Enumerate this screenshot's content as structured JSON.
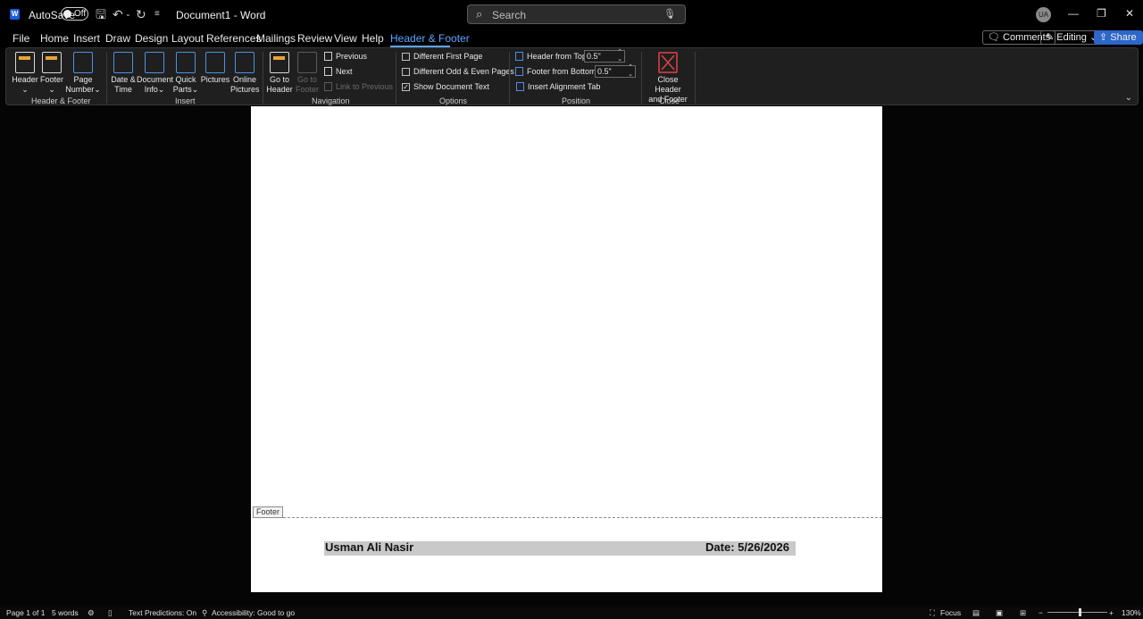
{
  "titlebar": {
    "logo": "W",
    "autosave_label": "AutoSave",
    "autosave_state": "Off",
    "doc_title": "Document1  -  Word",
    "search_placeholder": "Search",
    "avatar_initials": "UA"
  },
  "menu": {
    "items": [
      "File",
      "Home",
      "Insert",
      "Draw",
      "Design",
      "Layout",
      "References",
      "Mailings",
      "Review",
      "View",
      "Help",
      "Header & Footer"
    ],
    "comments": "Comments",
    "editing": "Editing",
    "share": "Share"
  },
  "ribbon": {
    "header_footer_group": {
      "label": "Header & Footer",
      "header": "Header",
      "footer": "Footer",
      "page_number_1": "Page",
      "page_number_2": "Number"
    },
    "insert_group": {
      "label": "Insert",
      "date_time_1": "Date &",
      "date_time_2": "Time",
      "doc_info_1": "Document",
      "doc_info_2": "Info",
      "quick_parts_1": "Quick",
      "quick_parts_2": "Parts",
      "pictures": "Pictures",
      "online_pictures_1": "Online",
      "online_pictures_2": "Pictures"
    },
    "navigation_group": {
      "label": "Navigation",
      "goto_header_1": "Go to",
      "goto_header_2": "Header",
      "goto_footer_1": "Go to",
      "goto_footer_2": "Footer",
      "previous": "Previous",
      "next": "Next",
      "link_to_previous": "Link to Previous"
    },
    "options_group": {
      "label": "Options",
      "different_first_page": "Different First Page",
      "different_odd_even": "Different Odd & Even Pages",
      "show_document_text": "Show Document Text"
    },
    "position_group": {
      "label": "Position",
      "header_from_top": "Header from Top:",
      "header_from_top_value": "0.5\"",
      "footer_from_bottom": "Footer from Bottom:",
      "footer_from_bottom_value": "0.5\"",
      "insert_alignment_tab": "Insert Alignment Tab"
    },
    "close_group": {
      "label": "Close",
      "close_1": "Close Header",
      "close_2": "and Footer"
    }
  },
  "document": {
    "footer_tag": "Footer",
    "footer_name": "Usman Ali Nasir",
    "footer_date": "Date: 5/26/2026"
  },
  "status": {
    "page": "Page 1 of 1",
    "words": "5 words",
    "text_predictions": "Text Predictions: On",
    "accessibility": "Accessibility: Good to go",
    "focus": "Focus",
    "zoom": "130%"
  },
  "colors": {
    "accent": "#5ea5ff",
    "share": "#2c67c9",
    "word_brand": "#1e5bd6"
  }
}
